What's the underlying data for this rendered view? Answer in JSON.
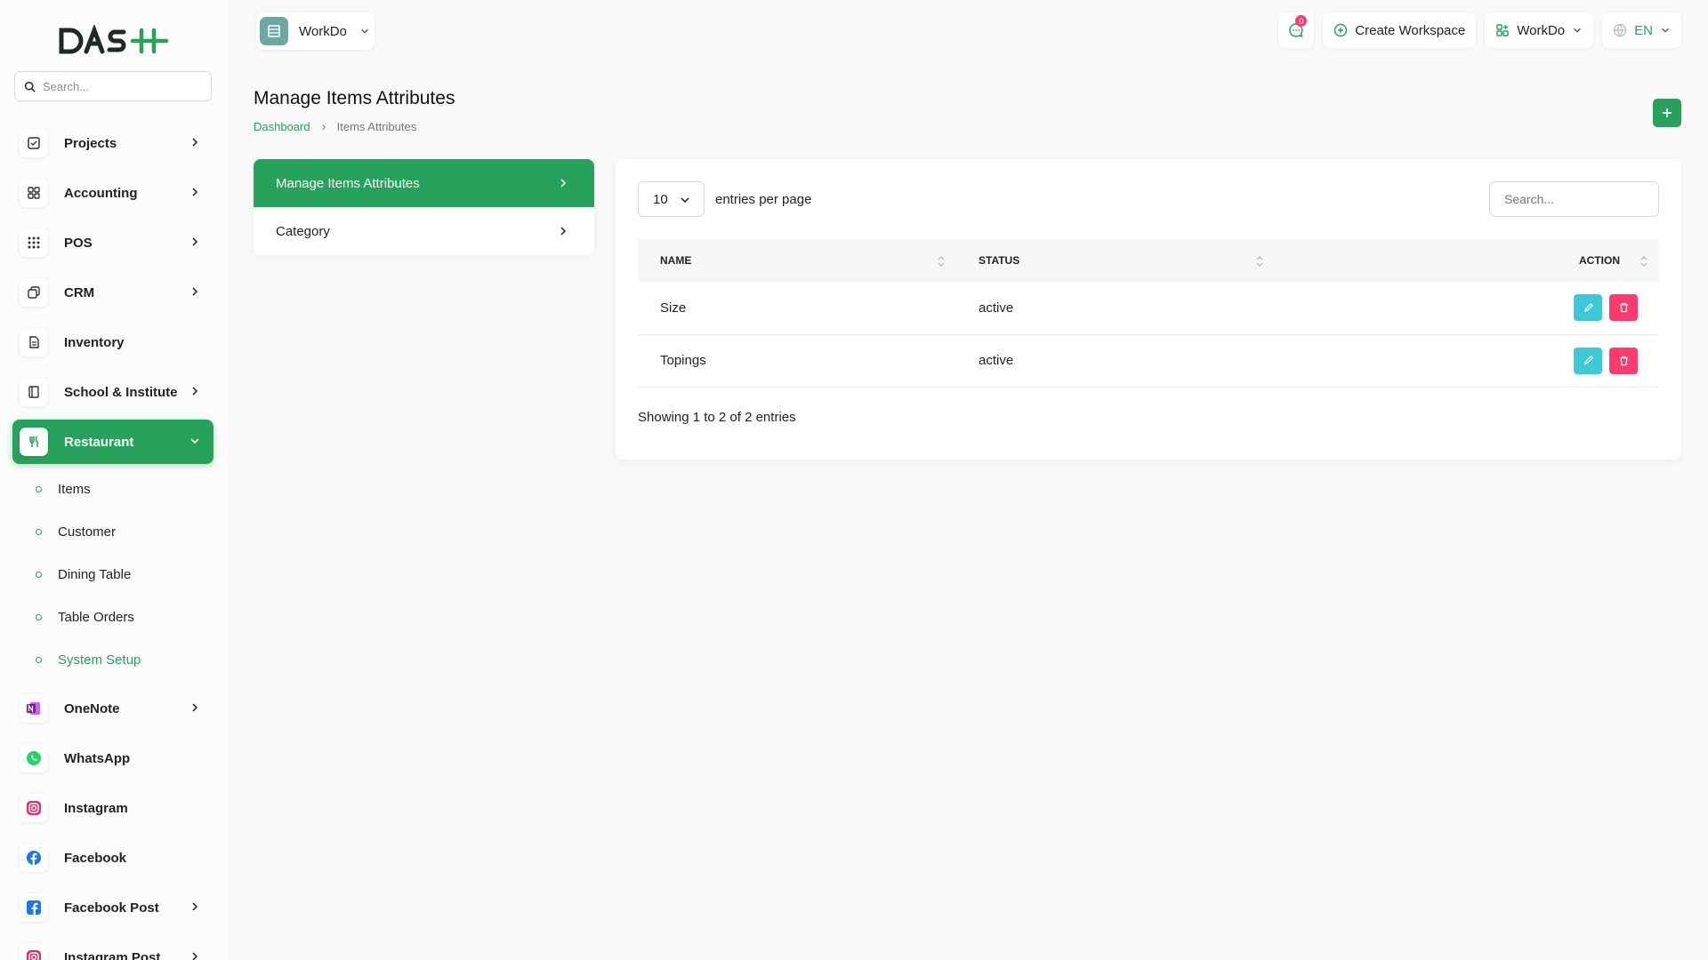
{
  "brand": {
    "name": "DASH",
    "accent": "#26a25a"
  },
  "sidebar": {
    "search_placeholder": "Search...",
    "items": [
      {
        "label": "Projects",
        "icon": "check-square-icon",
        "has_children": true
      },
      {
        "label": "Accounting",
        "icon": "grid-icon",
        "has_children": true
      },
      {
        "label": "POS",
        "icon": "dots-grid-icon",
        "has_children": true
      },
      {
        "label": "CRM",
        "icon": "layers-icon",
        "has_children": true
      },
      {
        "label": "Inventory",
        "icon": "file-icon",
        "has_children": false
      },
      {
        "label": "School & Institute",
        "icon": "book-icon",
        "has_children": true
      },
      {
        "label": "Restaurant",
        "icon": "utensils-icon",
        "has_children": true,
        "active": true
      }
    ],
    "restaurant_sub": [
      {
        "label": "Items"
      },
      {
        "label": "Customer"
      },
      {
        "label": "Dining Table"
      },
      {
        "label": "Table Orders"
      },
      {
        "label": "System Setup",
        "current": true
      }
    ],
    "items_after": [
      {
        "label": "OneNote",
        "icon": "onenote-icon",
        "has_children": true
      },
      {
        "label": "WhatsApp",
        "icon": "whatsapp-icon",
        "has_children": false
      },
      {
        "label": "Instagram",
        "icon": "instagram-icon",
        "has_children": false
      },
      {
        "label": "Facebook",
        "icon": "facebook-icon",
        "has_children": false
      },
      {
        "label": "Facebook Post",
        "icon": "facebook-post-icon",
        "has_children": true
      },
      {
        "label": "Instagram Post",
        "icon": "instagram-post-icon",
        "has_children": true
      }
    ]
  },
  "header": {
    "workspace": "WorkDo",
    "notification_count": "0",
    "create_workspace": "Create Workspace",
    "workspace_menu": "WorkDo",
    "language": "EN"
  },
  "page": {
    "title": "Manage Items Attributes",
    "breadcrumb": {
      "home": "Dashboard",
      "current": "Items Attributes"
    }
  },
  "left_menu": [
    {
      "label": "Manage Items Attributes",
      "active": true
    },
    {
      "label": "Category",
      "active": false
    }
  ],
  "table": {
    "per_page_value": "10",
    "per_page_text": "entries per page",
    "search_placeholder": "Search...",
    "columns": [
      "NAME",
      "STATUS",
      "ACTION"
    ],
    "rows": [
      {
        "name": "Size",
        "status": "active"
      },
      {
        "name": "Topings",
        "status": "active"
      }
    ],
    "footer": "Showing 1 to 2 of 2 entries"
  }
}
